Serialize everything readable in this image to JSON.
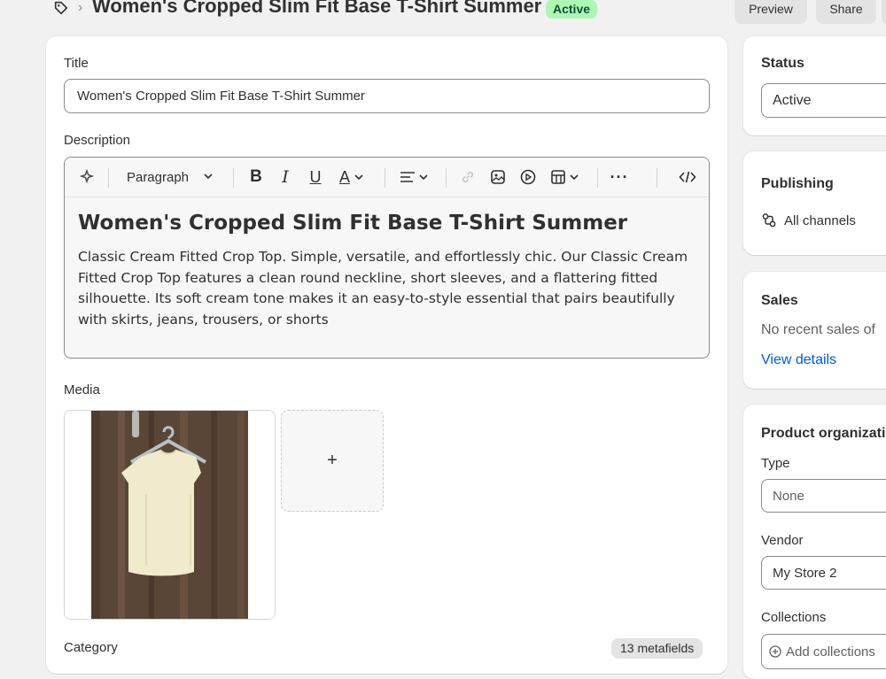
{
  "header": {
    "title": "Women's Cropped Slim Fit Base T-Shirt Summer",
    "status_badge": "Active",
    "preview_label": "Preview",
    "share_label": "Share"
  },
  "title_section": {
    "label": "Title",
    "value": "Women's Cropped Slim Fit Base T-Shirt Summer"
  },
  "description": {
    "label": "Description",
    "format_select": "Paragraph",
    "heading": "Women's Cropped Slim Fit Base T-Shirt Summer",
    "body": "Classic Cream Fitted Crop Top. Simple, versatile, and effortlessly chic. Our Classic Cream Fitted Crop Top features a clean round neckline, short sleeves, and a flattering fitted silhouette. Its soft cream tone makes it an easy-to-style essential that pairs beautifully with skirts, jeans, trousers, or shorts"
  },
  "media": {
    "label": "Media",
    "add_glyph": "+"
  },
  "category": {
    "label": "Category",
    "metafields": "13 metafields"
  },
  "sidebar": {
    "status": {
      "title": "Status",
      "value": "Active"
    },
    "publishing": {
      "title": "Publishing",
      "channels": "All channels"
    },
    "sales": {
      "title": "Sales",
      "text": "No recent sales of",
      "link": "View details"
    },
    "organization": {
      "title": "Product organizati",
      "type_label": "Type",
      "type_value": "None",
      "vendor_label": "Vendor",
      "vendor_value": "My Store 2",
      "collections_label": "Collections",
      "collections_value": "Add collections"
    }
  },
  "colors": {
    "accent_link": "#005bd3",
    "badge_bg": "#aff5b4",
    "badge_text": "#0c5132"
  }
}
